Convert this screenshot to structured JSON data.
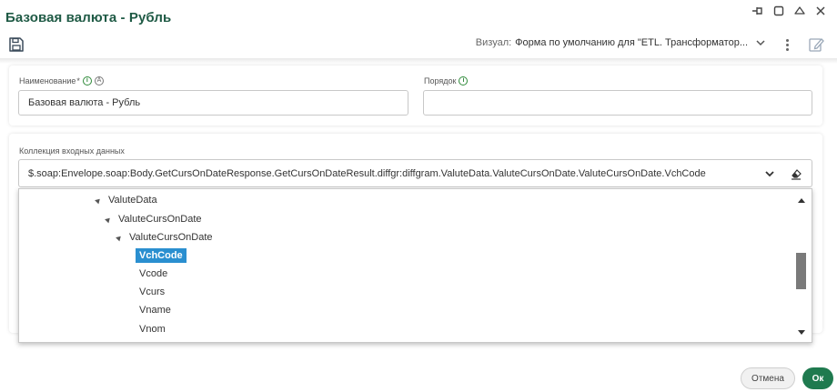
{
  "window": {
    "title": "Базовая валюта - Рубль"
  },
  "toolbar": {
    "visual_label": "Визуал:",
    "visual_value": "Форма по умолчанию для \"ETL. Трансформатор..."
  },
  "fields": {
    "name_label": "Наименование",
    "name_required": "*",
    "name_value": "Базовая валюта - Рубль",
    "order_label": "Порядок",
    "order_value": "",
    "collection_label": "Коллекция входных данных",
    "collection_value": "$.soap:Envelope.soap:Body.GetCursOnDateResponse.GetCursOnDateResult.diffgr:diffgram.ValuteData.ValuteCursOnDate.ValuteCursOnDate.VchCode"
  },
  "tree": {
    "items": [
      {
        "label": "ValuteData",
        "expanded": true
      },
      {
        "label": "ValuteCursOnDate",
        "expanded": true
      },
      {
        "label": "ValuteCursOnDate",
        "expanded": true
      },
      {
        "label": "VchCode",
        "selected": true
      },
      {
        "label": "Vcode"
      },
      {
        "label": "Vcurs"
      },
      {
        "label": "Vname"
      },
      {
        "label": "Vnom"
      }
    ]
  },
  "buttons": {
    "cancel": "Отмена",
    "ok": "Ок"
  },
  "colors": {
    "accent": "#1f7a4f",
    "title": "#1f5a45",
    "selection": "#2a8fd0"
  }
}
